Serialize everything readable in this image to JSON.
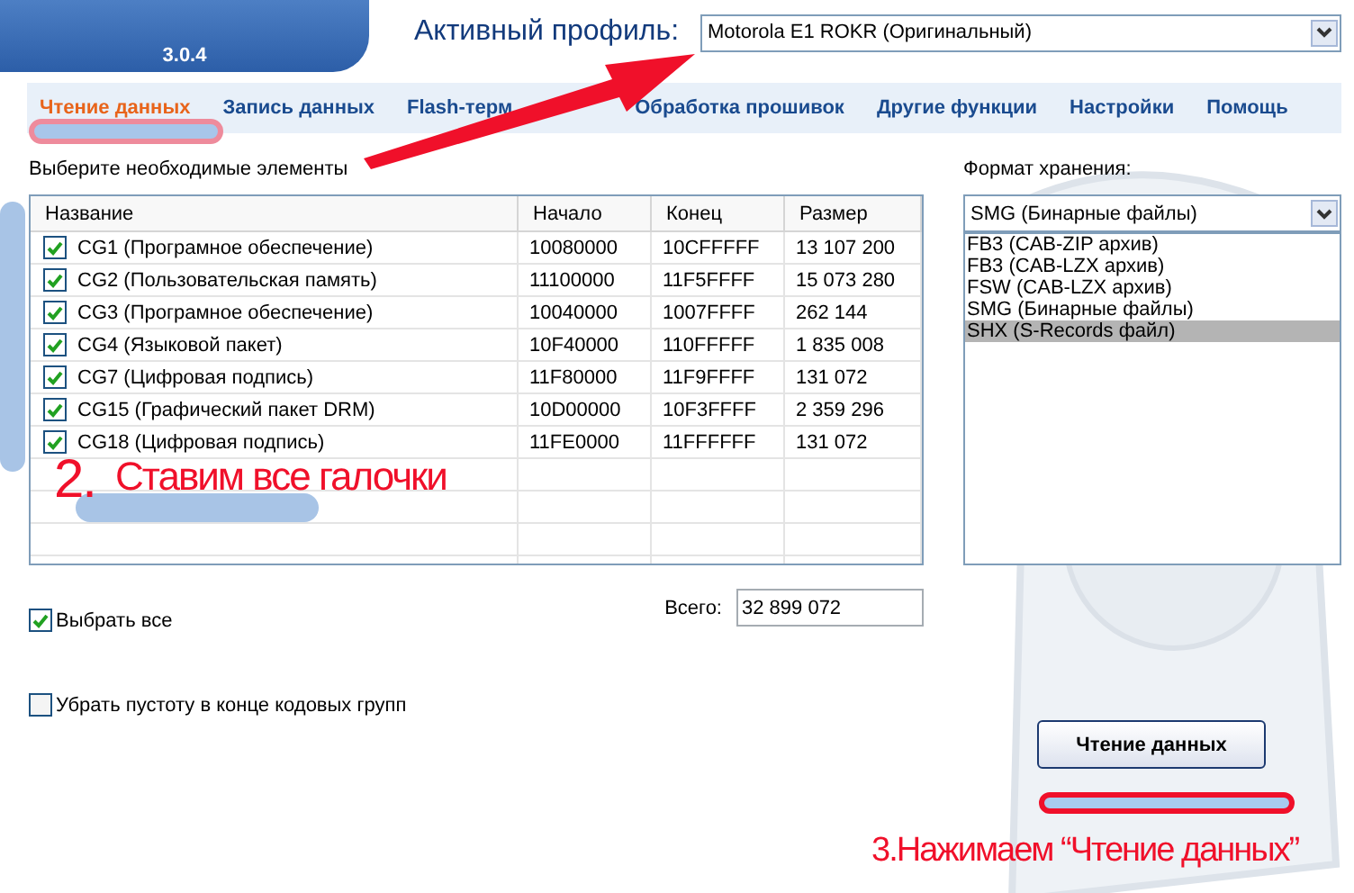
{
  "app": {
    "version": "3.0.4"
  },
  "profile": {
    "label": "Активный профиль:",
    "value": "Motorola E1 ROKR (Оригинальный)"
  },
  "tabs": [
    {
      "label": "Чтение данных",
      "selected": true
    },
    {
      "label": "Запись данных",
      "selected": false
    },
    {
      "label": "Flash-терм",
      "selected": false
    },
    {
      "label": "Обработка прошивок",
      "selected": false
    },
    {
      "label": "Другие функции",
      "selected": false
    },
    {
      "label": "Настройки",
      "selected": false
    },
    {
      "label": "Помощь",
      "selected": false
    }
  ],
  "elements": {
    "label": "Выберите необходимые элементы",
    "columns": [
      "Название",
      "Начало",
      "Конец",
      "Размер"
    ],
    "rows": [
      {
        "checked": true,
        "name": "CG1 (Програмное обеспечение)",
        "start": "10080000",
        "end": "10CFFFFF",
        "size": "13 107 200"
      },
      {
        "checked": true,
        "name": "CG2 (Пользовательская память)",
        "start": "11100000",
        "end": "11F5FFFF",
        "size": "15 073 280"
      },
      {
        "checked": true,
        "name": "CG3 (Програмное обеспечение)",
        "start": "10040000",
        "end": "1007FFFF",
        "size": "262 144"
      },
      {
        "checked": true,
        "name": "CG4 (Языковой пакет)",
        "start": "10F40000",
        "end": "110FFFFF",
        "size": "1 835 008"
      },
      {
        "checked": true,
        "name": "CG7 (Цифровая подпись)",
        "start": "11F80000",
        "end": "11F9FFFF",
        "size": "131 072"
      },
      {
        "checked": true,
        "name": "CG15 (Графический пакет DRM)",
        "start": "10D00000",
        "end": "10F3FFFF",
        "size": "2 359 296"
      },
      {
        "checked": true,
        "name": "CG18 (Цифровая подпись)",
        "start": "11FE0000",
        "end": "11FFFFFF",
        "size": "131 072"
      }
    ]
  },
  "select_all": {
    "label": "Выбрать все",
    "checked": true
  },
  "total": {
    "label": "Всего:",
    "value": "32 899 072"
  },
  "trim_empty": {
    "label": "Убрать пустоту в конце кодовых групп",
    "checked": false
  },
  "format": {
    "label": "Формат хранения:",
    "value": "SMG (Бинарные файлы)",
    "options": [
      {
        "label": "FB3 (CAB-ZIP архив)",
        "highlighted": false
      },
      {
        "label": "FB3 (CAB-LZX архив)",
        "highlighted": false
      },
      {
        "label": "FSW (CAB-LZX архив)",
        "highlighted": false
      },
      {
        "label": "SMG (Бинарные файлы)",
        "highlighted": false
      },
      {
        "label": "SHX (S-Records файл)",
        "highlighted": true
      }
    ]
  },
  "read_button": {
    "label": "Чтение данных"
  },
  "annotations": {
    "step_2_number": "2.",
    "step_2_text": "Ставим все галочки",
    "step_3_text": "3.Нажимаем “Чтение данных”"
  }
}
